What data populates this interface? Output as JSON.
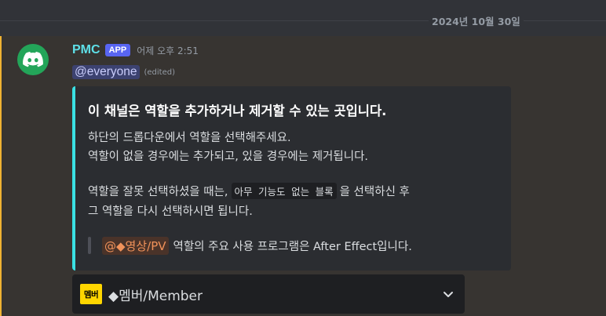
{
  "date_divider": "2024년 10월 30일",
  "message": {
    "username": "PMC",
    "badge": "APP",
    "timestamp": "어제 오후 2:51",
    "mention": "@everyone",
    "edited": "(edited)"
  },
  "embed": {
    "title": "이 채널은 역할을 추가하거나 제거할 수 있는 곳입니다.",
    "line1": "하단의 드롭다운에서 역할을 선택해주세요.",
    "line2": "역할이 없을 경우에는 추가되고, 있을 경우에는 제거됩니다.",
    "line3_before": "역할을 잘못 선택하셨을 때는,",
    "line3_code": "아무 기능도 없는 블록",
    "line3_after": "을 선택하신 후",
    "line4": "그 역할을 다시 선택하시면 됩니다.",
    "quote_role": "@◆영상/PV",
    "quote_text": "역할의 주요 사용 프로그램은 After Effect입니다."
  },
  "select": {
    "emoji_text": "멤버",
    "value": "◆멤버/Member"
  },
  "colors": {
    "accent": "#3ae0e3",
    "username": "#5ee0e8",
    "app_badge": "#5865f2",
    "mention_bar": "#f0b232",
    "role_mention": "#f0925a",
    "avatar": "#23a559"
  },
  "icons": {
    "avatar": "discord-icon",
    "select_chevron": "chevron-down-icon"
  }
}
